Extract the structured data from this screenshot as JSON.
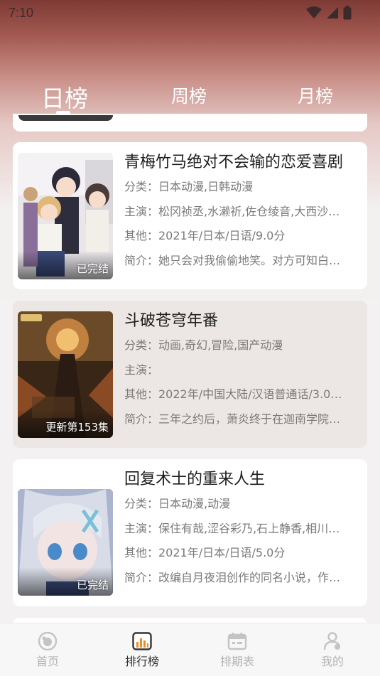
{
  "status_bar": {
    "time": "7:10"
  },
  "tabs": [
    {
      "label": "日榜",
      "active": true
    },
    {
      "label": "周榜",
      "active": false
    },
    {
      "label": "月榜",
      "active": false
    }
  ],
  "items": [
    {
      "title": "青梅竹马绝对不会输的恋爱喜剧",
      "category": "分类：日本动漫,日韩动漫",
      "cast": "主演：松冈祯丞,水濑祈,佐仓绫音,大西沙…",
      "other": "其他：2021年/日本/日语/9.0分",
      "intro": "简介：她只会对我偷偷地笑。对方可知白…",
      "status": "已完结"
    },
    {
      "title": "斗破苍穹年番",
      "category": "分类：动画,奇幻,冒险,国产动漫",
      "cast": "主演：",
      "other": "其他：2022年/中国大陆/汉语普通话/3.0…",
      "intro": "简介：三年之约后，萧炎终于在迦南学院…",
      "status": "更新第153集"
    },
    {
      "title": "回复术士的重来人生",
      "category": "分类：日本动漫,动漫",
      "cast": "主演：保住有哉,涩谷彩乃,石上静香,相川…",
      "other": "其他：2021年/日本/日语/5.0分",
      "intro": "简介：改编自月夜泪创作的同名小说，作…",
      "status": "已完结"
    }
  ],
  "bottom_nav": [
    {
      "label": "首页",
      "icon": "home-icon",
      "active": false
    },
    {
      "label": "排行榜",
      "icon": "ranking-icon",
      "active": true
    },
    {
      "label": "排期表",
      "icon": "calendar-icon",
      "active": false
    },
    {
      "label": "我的",
      "icon": "profile-icon",
      "active": false
    }
  ],
  "colors": {
    "accent": "#f08a24",
    "inactive": "#b3b3b3"
  }
}
